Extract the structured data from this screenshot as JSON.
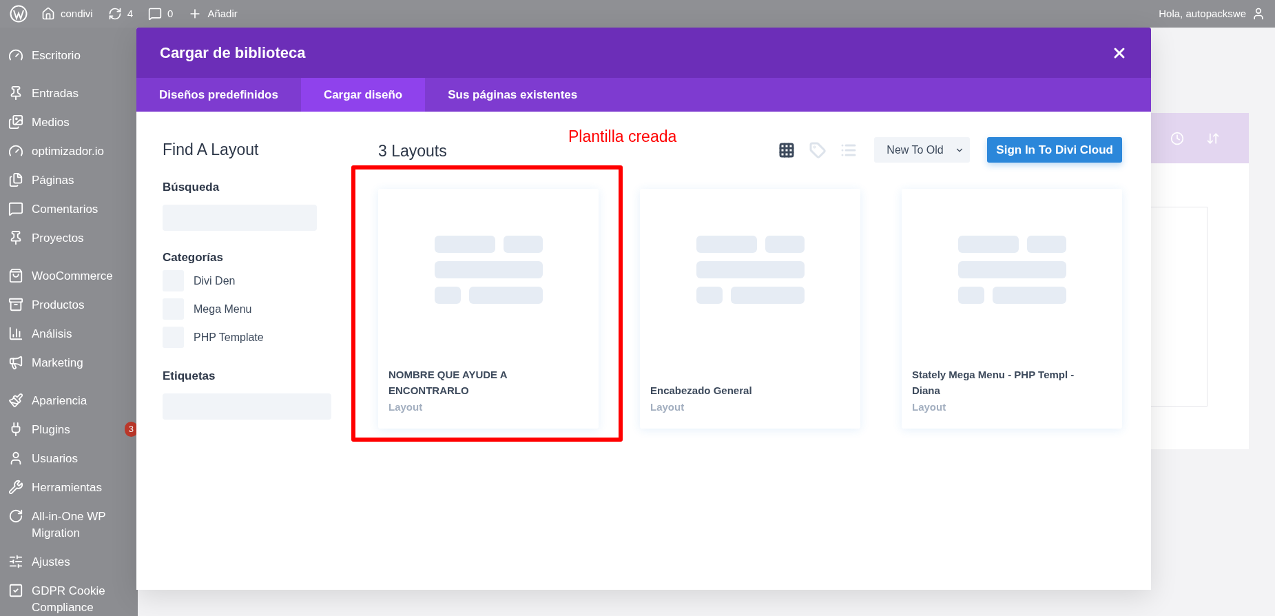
{
  "admin_bar": {
    "site": "condivi",
    "updates": "4",
    "comments": "0",
    "new": "Añadir",
    "greeting": "Hola, autopackswe"
  },
  "sidebar": {
    "items": [
      {
        "label": "Escritorio"
      },
      {
        "label": "Entradas"
      },
      {
        "label": "Medios"
      },
      {
        "label": "optimizador.io"
      },
      {
        "label": "Páginas"
      },
      {
        "label": "Comentarios"
      },
      {
        "label": "Proyectos"
      },
      {
        "label": "WooCommerce"
      },
      {
        "label": "Productos"
      },
      {
        "label": "Análisis"
      },
      {
        "label": "Marketing"
      },
      {
        "label": "Apariencia"
      },
      {
        "label": "Plugins",
        "badge": "3"
      },
      {
        "label": "Usuarios"
      },
      {
        "label": "Herramientas"
      },
      {
        "label": "All-in-One WP Migration"
      },
      {
        "label": "Ajustes"
      },
      {
        "label": "GDPR Cookie Compliance"
      }
    ]
  },
  "modal": {
    "title": "Cargar de biblioteca",
    "tabs": [
      {
        "label": "Diseños predefinidos",
        "selected": false
      },
      {
        "label": "Cargar diseño",
        "selected": true
      },
      {
        "label": "Sus páginas existentes",
        "selected": false
      }
    ],
    "filters": {
      "heading": "Find A Layout",
      "search_label": "Búsqueda",
      "categories_label": "Categorías",
      "categories": [
        {
          "label": "Divi Den",
          "checked": false
        },
        {
          "label": "Mega Menu",
          "checked": false
        },
        {
          "label": "PHP Template",
          "checked": false
        }
      ],
      "tags_label": "Etiquetas"
    },
    "count": "3 Layouts",
    "annotation": "Plantilla creada",
    "view_buttons": [
      {
        "selected": true
      },
      {
        "selected": false
      },
      {
        "selected": false
      }
    ],
    "sort": "New To Old",
    "cloud_button": "Sign In To Divi Cloud",
    "cards": [
      {
        "title": "NOMBRE QUE AYUDE A ENCONTRARLO",
        "type": "Layout",
        "annotated": true
      },
      {
        "title": "Encabezado General",
        "type": "Layout",
        "annotated": false
      },
      {
        "title": "Stately Mega Menu - PHP Templ - Diana",
        "type": "Layout",
        "annotated": false
      }
    ]
  }
}
